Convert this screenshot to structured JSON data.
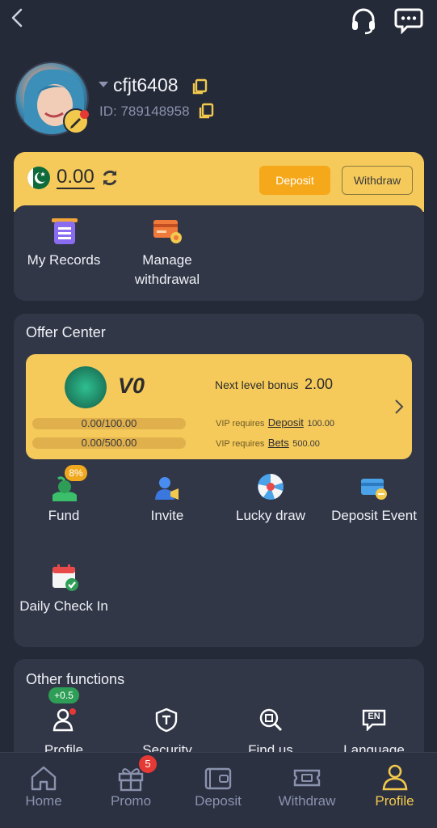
{
  "header": {
    "back_icon": "back-arrow-icon",
    "support_icon": "headset-icon",
    "message_icon": "chat-bubble-icon"
  },
  "profile": {
    "username": "cfjt6408",
    "id_text": "ID: 789148958"
  },
  "wallet": {
    "balance": "0.00",
    "deposit_label": "Deposit",
    "withdraw_label": "Withdraw",
    "currency_icon": "pakistan-flag-icon"
  },
  "quick_actions": [
    {
      "label": "My Records",
      "icon": "records-icon"
    },
    {
      "label": "Manage withdrawal",
      "icon": "manage-withdrawal-icon"
    }
  ],
  "offer_center": {
    "title": "Offer Center",
    "vip": {
      "level": "V0",
      "next_bonus_label": "Next level bonus",
      "next_bonus_value": "2.00",
      "progress1": "0.00/100.00",
      "progress2": "0.00/500.00",
      "req1_prefix": "VIP requires",
      "req1_link": "Deposit",
      "req1_value": "100.00",
      "req2_prefix": "VIP requires",
      "req2_link": "Bets",
      "req2_value": "500.00"
    },
    "items": [
      {
        "label": "Fund",
        "badge": "8%",
        "icon": "fund-icon"
      },
      {
        "label": "Invite",
        "icon": "invite-icon"
      },
      {
        "label": "Lucky draw",
        "icon": "lucky-wheel-icon"
      },
      {
        "label": "Deposit Event",
        "icon": "deposit-event-icon"
      },
      {
        "label": "Daily Check In",
        "icon": "calendar-check-icon"
      }
    ]
  },
  "other_functions": {
    "title": "Other functions",
    "items": [
      {
        "label": "Profile",
        "badge": "+0.5",
        "icon": "profile-edit-icon"
      },
      {
        "label": "Security",
        "icon": "security-shield-icon"
      },
      {
        "label": "Find us",
        "icon": "find-us-icon"
      },
      {
        "label": "Language",
        "icon": "language-icon",
        "icon_text": "EN"
      }
    ]
  },
  "bottom_nav": {
    "items": [
      {
        "label": "Home",
        "icon": "home-icon"
      },
      {
        "label": "Promo",
        "icon": "gift-icon",
        "badge": "5"
      },
      {
        "label": "Deposit",
        "icon": "wallet-icon"
      },
      {
        "label": "Withdraw",
        "icon": "ticket-icon"
      },
      {
        "label": "Profile",
        "icon": "person-icon"
      }
    ],
    "active": "Profile"
  },
  "colors": {
    "background": "#252a38",
    "card": "#323748",
    "accent_gold": "#f5ca5b",
    "deposit_orange": "#f6a81b",
    "active_nav": "#f2c94c"
  }
}
